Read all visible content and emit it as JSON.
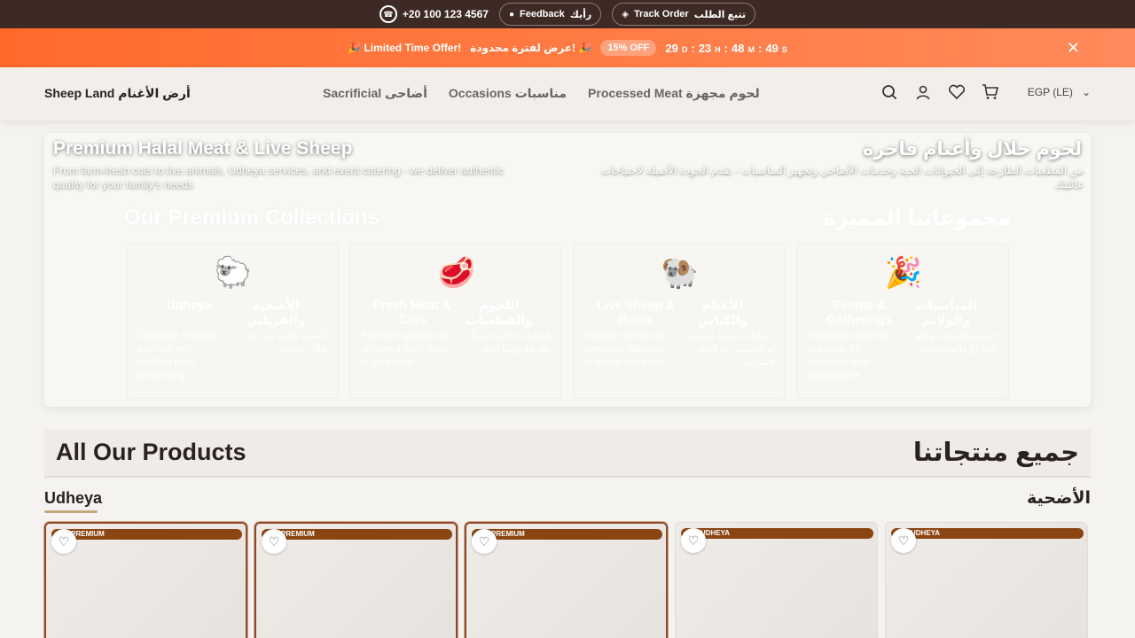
{
  "topbar": {
    "phone": "+20 100 123 4567",
    "feedback_en": "Feedback",
    "feedback_ar": "رأيك",
    "track_en": "Track Order",
    "track_ar": "تتبع الطلب"
  },
  "promo": {
    "text_en": "🎉 Limited Time Offer!",
    "text_ar": "عرض لفترة محدودة! 🎉",
    "discount": "15% OFF",
    "days": "29",
    "days_unit": "D",
    "hours": "23",
    "hours_unit": "H",
    "minutes": "48",
    "minutes_unit": "M",
    "seconds": "49",
    "seconds_unit": "S",
    "close": "✕"
  },
  "header": {
    "brand": "Sheep Land  أرض الأغنام",
    "nav": [
      "Sacrificial  أضاحى",
      "Occasions  مناسبات",
      "Processed Meat  لحوم مجهزة"
    ],
    "currency": "EGP (LE)"
  },
  "hero": {
    "title_en": "Premium Halal Meat & Live Sheep",
    "title_ar": "لحوم حلال وأغنام فاخرة",
    "subtitle_en": "From farm-fresh cuts to live animals, Udheya services, and event catering - we deliver authentic quality for your family's needs",
    "subtitle_ar": "من القطعيات الطازجة إلى الحيوانات الحية وخدمات الأضاحي وتجهيز المناسبات - نقدم الجودة الأصيلة لاحتياجات عائلتك",
    "collections_en": "Our Premium Collections",
    "collections_ar": "مجموعاتنا المميزة",
    "tiles": [
      {
        "emoji": "🐑",
        "title_en": "Udheya",
        "title_ar": "الأضحية والقرباني",
        "desc_en": "Complete religious sacrifice with certified halal processing",
        "desc_ar": "أضحية كاملة مع ذبح حلال معتمد"
      },
      {
        "emoji": "🥩",
        "title_en": "Fresh Meat & Cuts",
        "title_ar": "اللحوم والقطعيات",
        "desc_en": "Premium quality cuts delivered fresh daily to your door",
        "desc_ar": "قطعيات فاخرة تصلك طازجة يوميا لبابك"
      },
      {
        "emoji": "🐏",
        "title_en": "Live Sheep & Rams",
        "title_ar": "الأغنام والكباش",
        "desc_en": "Healthy animals for breeding, fattening, or home slaughter",
        "desc_ar": "حيوانات صحية للتربية أو التسمين أو الذبح المنزلي"
      },
      {
        "emoji": "🎉",
        "title_en": "Events & Gatherings",
        "title_ar": "المناسبات والولائم",
        "desc_en": "Complete catering solutions for weddings and celebrations",
        "desc_ar": "حلول متكاملة للولائم للأفراح والمناسبات"
      }
    ]
  },
  "products": {
    "title_en": "All Our Products",
    "title_ar": "جميع منتجاتنا",
    "category_en": "Udheya",
    "category_ar": "الأضحية",
    "cards": [
      {
        "badge": "PREMIUM"
      },
      {
        "badge": "PREMIUM"
      },
      {
        "badge": "PREMIUM"
      },
      {
        "badge": "UDHEYA"
      },
      {
        "badge": "UDHEYA"
      }
    ]
  }
}
